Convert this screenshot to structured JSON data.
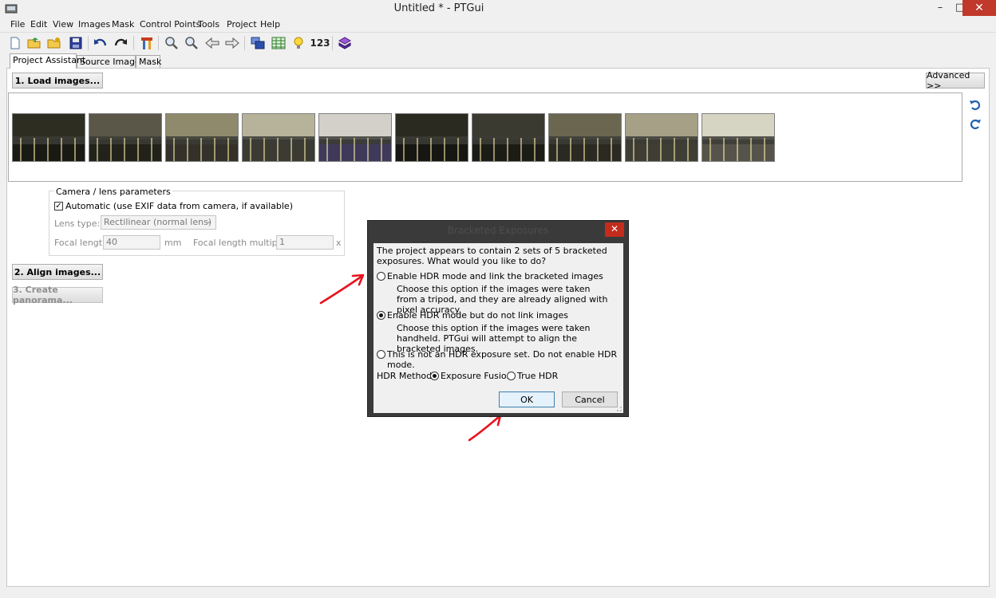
{
  "window": {
    "title": "Untitled * - PTGui",
    "minimize": "–",
    "maximize": "□",
    "close": "✕"
  },
  "menu": [
    "File",
    "Edit",
    "View",
    "Images",
    "Mask",
    "Control Points",
    "Tools",
    "Project",
    "Help"
  ],
  "toolbar": {
    "icons": [
      "new-icon",
      "open-icon",
      "open-recent-icon",
      "save-icon",
      "undo-icon",
      "redo-icon",
      "tools-icon",
      "zoom-in-icon",
      "zoom-out-icon",
      "previous-icon",
      "next-icon",
      "panorama-editor-icon",
      "control-points-table-icon",
      "tips-icon",
      "numbers-icon",
      "batch-icon"
    ],
    "numbers_label": "123"
  },
  "tabs": [
    "Project Assistant",
    "Source Images",
    "Mask"
  ],
  "buttons": {
    "load_images": "1. Load images...",
    "advanced": "Advanced >>",
    "align_images": "2. Align images...",
    "create_panorama": "3. Create panorama..."
  },
  "thumbnails": [
    {
      "sky": "#2d2d22",
      "water": "#1a1a14"
    },
    {
      "sky": "#5a5648",
      "water": "#22221b"
    },
    {
      "sky": "#8f8a6c",
      "water": "#33312a"
    },
    {
      "sky": "#b7b39a",
      "water": "#3b3b34"
    },
    {
      "sky": "#d2d0c8",
      "water": "#3f3a5a"
    },
    {
      "sky": "#2b2a20",
      "water": "#161612"
    },
    {
      "sky": "#3a3a30",
      "water": "#1c1c17"
    },
    {
      "sky": "#6b6650",
      "water": "#2a2922"
    },
    {
      "sky": "#a5a086",
      "water": "#3f3e34"
    },
    {
      "sky": "#d6d4c2",
      "water": "#56544a"
    }
  ],
  "camera": {
    "group_title": "Camera / lens parameters",
    "automatic_label": "Automatic (use EXIF data from camera, if available)",
    "automatic_checked": true,
    "lens_type_label": "Lens type:",
    "lens_type_value": "Rectilinear (normal lens)",
    "focal_length_label": "Focal length:",
    "focal_length_value": "40",
    "focal_length_unit": "mm",
    "multiplier_label": "Focal length multiplier:",
    "multiplier_value": "1",
    "multiplier_unit": "x"
  },
  "dialog": {
    "title": "Bracketed Exposures",
    "close": "✕",
    "question": "The project appears to contain 2 sets of 5 bracketed exposures. What would you like to do?",
    "option1_label": "Enable HDR mode and link the bracketed images",
    "option1_desc": "Choose this option if the images were taken from a tripod, and they are already aligned with pixel accuracy.",
    "option2_label": "Enable HDR mode but do not link images",
    "option2_desc": "Choose this option if the images were taken handheld. PTGui will attempt to align the bracketed images.",
    "option3_label": "This is not an HDR exposure set. Do not enable HDR mode.",
    "selected_option": 2,
    "hdr_method_label": "HDR Method:",
    "method_exposure_fusion": "Exposure Fusion",
    "method_true_hdr": "True HDR",
    "selected_method": "Exposure Fusion",
    "ok": "OK",
    "cancel": "Cancel"
  },
  "colors": {
    "annotation_red": "#e8141e",
    "close_red": "#c42b1c",
    "rotate_blue": "#1f5fb0"
  }
}
